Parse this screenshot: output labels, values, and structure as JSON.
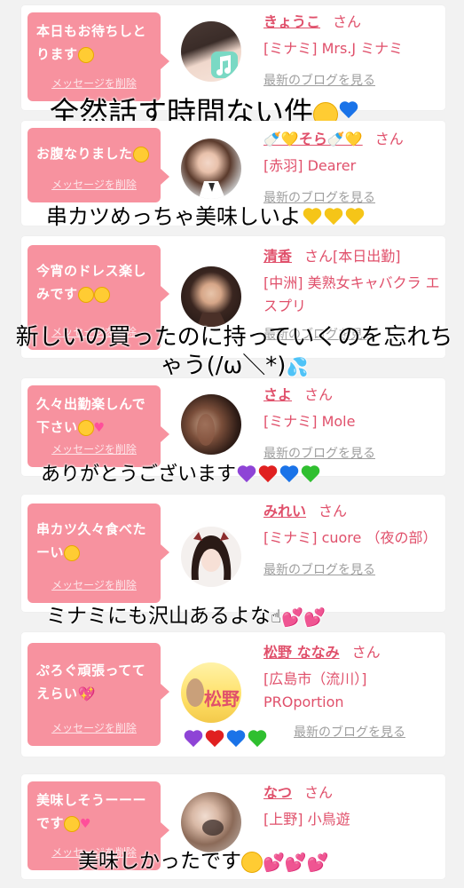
{
  "colors": {
    "accent": "#e0506b",
    "bubble": "#f7929f",
    "background": "#f2f2f2"
  },
  "delete_label": "メッセージを削除",
  "suffix_label": "さん",
  "blog_label": "最新のブログを見る",
  "posts": [
    {
      "message": "本日もお待ちしとります😊",
      "name": "きょうこ",
      "status": "",
      "shop": "[ミナミ] Mrs.J ミナミ",
      "avatar": "music-note-avatar-icon",
      "comment": "全然話す時間ない件🤣💙"
    },
    {
      "message": "お腹なりました😭",
      "name": "🍼💛そら🍼💛",
      "status": "",
      "shop": "[赤羽] Dearer",
      "avatar": "woman-photo-avatar",
      "comment": "串カツめっちゃ美味しいよ💛💛💛"
    },
    {
      "message": "今宵のドレス楽しみです🥰🥰",
      "name": "清香",
      "status": "[本日出勤]",
      "shop": "[中洲] 美熟女キャバクラ エスプリ",
      "avatar": "woman-photo-avatar",
      "comment_line1": "新しいの買ったのに持っていくのを忘れち",
      "comment_line2": "ゃう(/ω＼*)💦"
    },
    {
      "message": "久々出勤楽しんで下さい😃💗",
      "name": "さよ",
      "status": "",
      "shop": "[ミナミ] Mole",
      "avatar": "hair-photo-avatar",
      "comment": "ありがとうございます💜❤️💙💚"
    },
    {
      "message": "串カツ久々食べたーい🥰",
      "name": "みれい",
      "status": "",
      "shop": "[ミナミ] cuore （夜の部）",
      "avatar": "illustration-avatar",
      "comment": "ミナミにも沢山あるよな☝️💕💕"
    },
    {
      "message": "ぷろぐ頑張っててえらい💖",
      "name": "松野 ななみ",
      "status": "",
      "shop": "[広島市（流川）] PROportion",
      "avatar": "name-card-avatar",
      "avatar_text": "松野",
      "comment": "💜❤️💙💚"
    },
    {
      "message": "美味しそうーーーです🥰💗",
      "name": "なつ",
      "status": "",
      "shop": "[上野] 小鳥遊",
      "avatar": "woman-photo-avatar",
      "comment": "美味しかったです🥺💕💕💕"
    }
  ]
}
